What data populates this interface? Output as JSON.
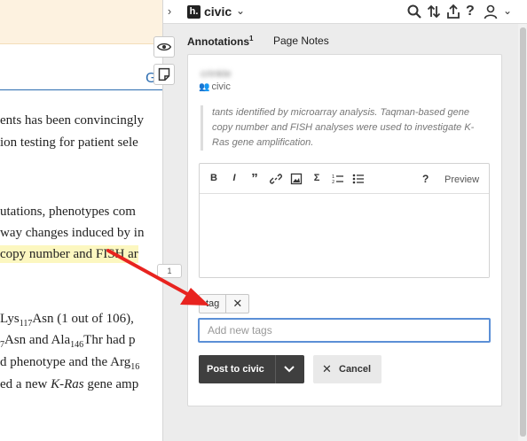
{
  "document": {
    "lines": [
      {
        "html": "ents has been convincingly"
      },
      {
        "html": "ion testing for patient sele"
      },
      {
        "html": "utations, phenotypes com"
      },
      {
        "html": "way changes induced by in"
      },
      {
        "html": "copy number and FISH ar"
      },
      {
        "html": "Lys<sub>117</sub>Asn (1 out of 106),"
      },
      {
        "html": "<sub>7</sub>Asn and Ala<sub>146</sub>Thr had p"
      },
      {
        "html": "d phenotype and the Arg<sub>16</sub>"
      },
      {
        "html": "ed a new <i>K-Ras</i> gene amp"
      }
    ]
  },
  "topbar": {
    "logo_glyph": "h.",
    "group": "civic",
    "icons": [
      "search-icon",
      "sort-icon",
      "share-icon",
      "help-icon",
      "user-icon",
      "caret-down-icon"
    ]
  },
  "tabs": {
    "annotations": "Annotations",
    "annotations_count": "1",
    "page_notes": "Page Notes"
  },
  "annotation": {
    "username": "crinkle",
    "group": "civic",
    "quote": "tants identified by microarray analysis. Taqman-based gene copy number and FISH analyses were used to investigate K-Ras gene amplification.",
    "editor": {
      "tools": [
        "B",
        "I",
        "”",
        "🔗",
        "▧",
        "Σ",
        "☰",
        "☰"
      ],
      "tool_names": [
        "bold-icon",
        "italic-icon",
        "quote-icon",
        "link-icon",
        "image-icon",
        "math-icon",
        "numbered-list-icon",
        "bullet-list-icon"
      ],
      "help": "?",
      "preview": "Preview",
      "body": ""
    },
    "tag": "tag",
    "tag_remove": "✕",
    "tag_placeholder": "Add new tags",
    "post_label": "Post to civic",
    "cancel_label": "Cancel"
  },
  "bucket_count": "1",
  "colors": {
    "arrow": "#e8231f",
    "highlight": "#fcf7c0",
    "focus": "#5b8fd6",
    "post_button": "#3f3f3f"
  }
}
